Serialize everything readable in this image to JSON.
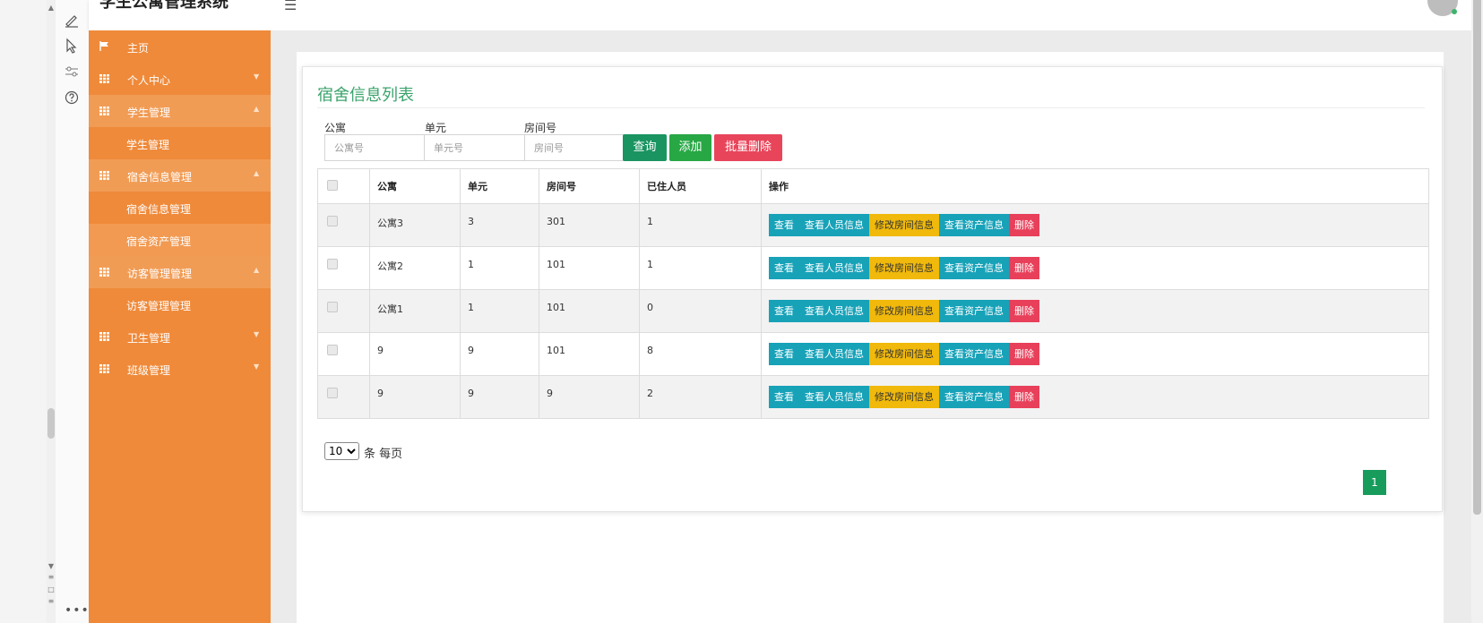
{
  "header": {
    "title": "学生公寓管理系统",
    "menu_icon": "hamburger-icon"
  },
  "sidebar": {
    "items": [
      {
        "label": "主页",
        "icon": "flag-icon"
      },
      {
        "label": "个人中心",
        "icon": "grid-icon"
      },
      {
        "label": "学生管理",
        "icon": "grid-icon"
      },
      {
        "label": "学生管理"
      },
      {
        "label": "宿舍信息管理",
        "icon": "grid-icon"
      },
      {
        "label": "宿舍信息管理"
      },
      {
        "label": "宿舍资产管理"
      },
      {
        "label": "访客管理管理",
        "icon": "grid-icon"
      },
      {
        "label": "访客管理管理"
      },
      {
        "label": "卫生管理",
        "icon": "grid-icon"
      },
      {
        "label": "班级管理",
        "icon": "grid-icon"
      }
    ]
  },
  "card": {
    "title": "宿舍信息列表",
    "filters": [
      {
        "label": "公寓",
        "placeholder": "公寓号"
      },
      {
        "label": "单元",
        "placeholder": "单元号"
      },
      {
        "label": "房间号",
        "placeholder": "房间号"
      }
    ],
    "buttons": {
      "search": "查询",
      "add": "添加",
      "batch_delete": "批量删除"
    },
    "colors": {
      "search": "#1a9460",
      "add": "#28a745",
      "batch_delete": "#e8455a",
      "title": "#3aa36b"
    }
  },
  "table": {
    "headers": [
      "公寓",
      "单元",
      "房间号",
      "已住人员",
      "操作"
    ],
    "rows": [
      [
        "公寓3",
        "3",
        "301",
        "1"
      ],
      [
        "公寓2",
        "1",
        "101",
        "1"
      ],
      [
        "公寓1",
        "1",
        "101",
        "0"
      ],
      [
        "9",
        "9",
        "101",
        "8"
      ],
      [
        "9",
        "9",
        "9",
        "2"
      ]
    ],
    "actions": [
      "查看",
      "查看人员信息",
      "修改房间信息",
      "查看资产信息",
      "删除"
    ]
  },
  "pagination": {
    "page_size": "10",
    "per_page_text": "条 每页",
    "current_page": "1"
  }
}
